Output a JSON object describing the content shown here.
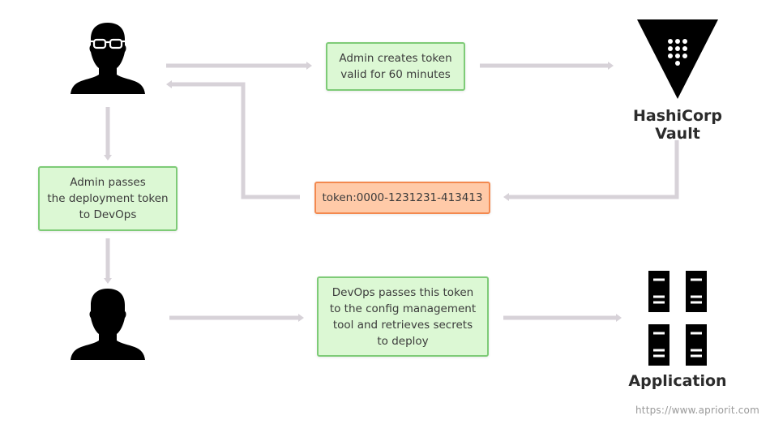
{
  "diagram": {
    "steps": {
      "create_token": "Admin creates token\nvalid for 60 minutes",
      "token_value": "token:0000-1231231-413413",
      "pass_token": "Admin passes\nthe deployment token\nto DevOps",
      "devops_step": "DevOps passes this token\nto the config management\ntool and retrieves secrets\nto deploy"
    },
    "actors": {
      "admin": {
        "icon": "admin-with-glasses-icon"
      },
      "devops": {
        "icon": "devops-user-icon"
      }
    },
    "systems": {
      "vault": {
        "label": "HashiCorp Vault",
        "icon": "hashicorp-vault-logo-icon"
      },
      "application": {
        "label": "Application",
        "icon": "server-rack-icon"
      }
    },
    "colors": {
      "arrow": "#d7d2d8",
      "green_fill": "#dcf8d4",
      "green_border": "#7ecb77",
      "orange_fill": "#ffcaa8",
      "orange_border": "#f3894f"
    }
  },
  "watermark": "https://www.apriorit.com"
}
